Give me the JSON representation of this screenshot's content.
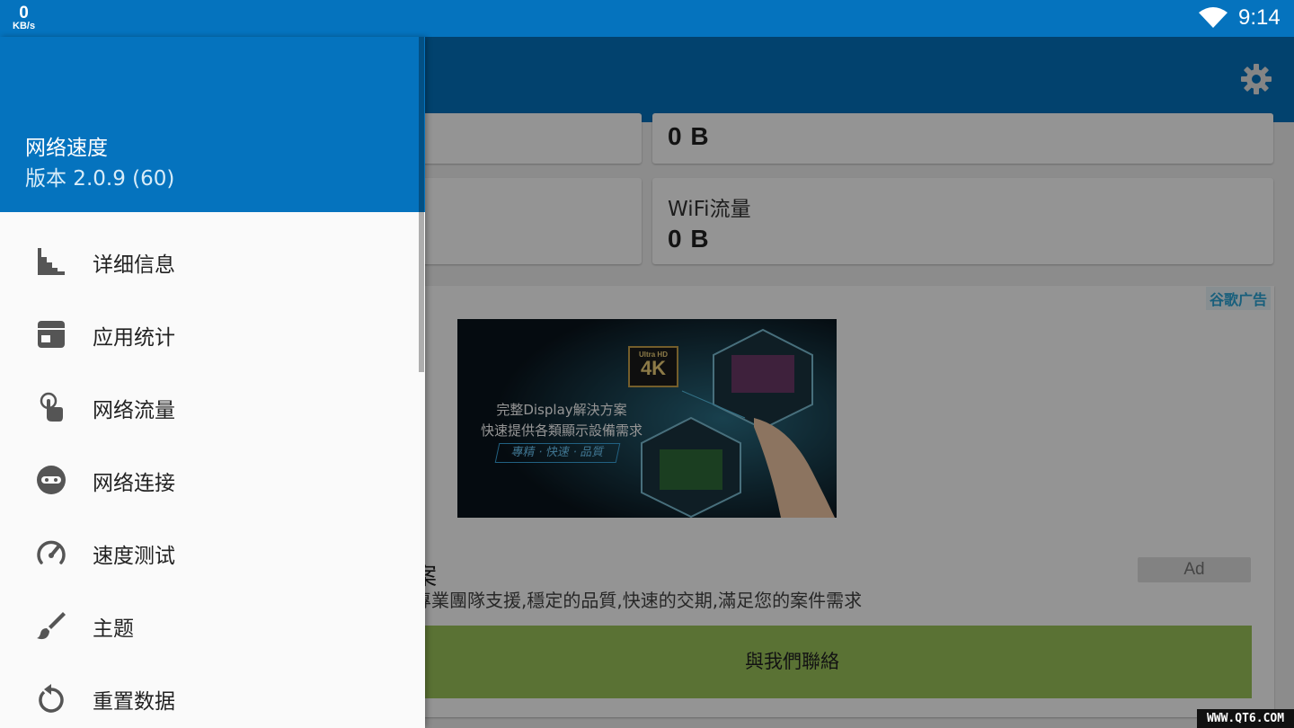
{
  "status_bar": {
    "net_speed_value": "0",
    "net_speed_unit": "KB/s",
    "time": "9:14"
  },
  "main": {
    "cards": [
      {
        "label": "",
        "value": "0 B"
      },
      {
        "label": "WiFi流量",
        "value": "0 B"
      }
    ],
    "ad": {
      "tag": "谷歌广告",
      "image_line1": "完整Display解決方案",
      "image_line2": "快速提供各類顯示設備需求",
      "image_line3": "專精 · 快速 · 品質",
      "image_badge_small": "Ultra HD",
      "image_badge_big": "4K",
      "headline": "案",
      "badge": "Ad",
      "body": "專業團隊支援,穩定的品質,快速的交期,滿足您的案件需求",
      "cta": "與我們聯絡"
    }
  },
  "drawer": {
    "title": "网络速度",
    "version": "版本 2.0.9 (60)",
    "items": [
      {
        "label": "详细信息",
        "icon": "stairs-chart-icon"
      },
      {
        "label": "应用统计",
        "icon": "archive-box-icon"
      },
      {
        "label": "网络流量",
        "icon": "touch-hand-icon"
      },
      {
        "label": "网络连接",
        "icon": "incognito-icon"
      },
      {
        "label": "速度测试",
        "icon": "speedometer-icon"
      },
      {
        "label": "主题",
        "icon": "brush-icon"
      },
      {
        "label": "重置数据",
        "icon": "reset-icon"
      }
    ]
  },
  "watermark": "WWW.QT6.COM"
}
